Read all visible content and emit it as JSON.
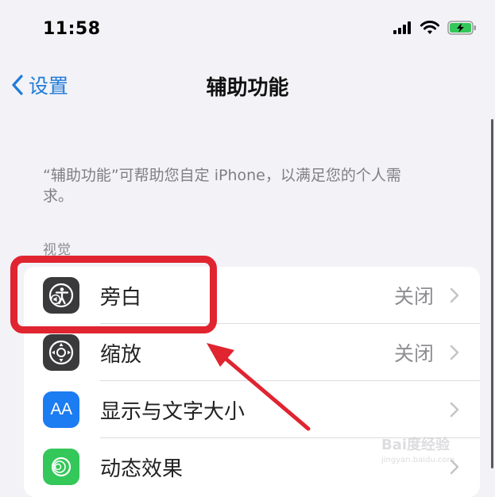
{
  "status_bar": {
    "time": "11:58",
    "icons": [
      "cellular-signal-icon",
      "wifi-icon",
      "battery-charging-icon"
    ]
  },
  "nav": {
    "back_label": "设置",
    "title": "辅助功能"
  },
  "description": "“辅助功能”可帮助您自定 iPhone，以满足您的个人需求。",
  "section_header": "视觉",
  "items": [
    {
      "label": "旁白",
      "value": "关闭",
      "icon": "voiceover-icon",
      "icon_color": "#3a3a3c"
    },
    {
      "label": "缩放",
      "value": "关闭",
      "icon": "zoom-icon",
      "icon_color": "#3a3a3c"
    },
    {
      "label": "显示与文字大小",
      "value": "",
      "icon": "display-text-size-icon",
      "icon_color": "#1c7cf2",
      "icon_text": "AA"
    },
    {
      "label": "动态效果",
      "value": "",
      "icon": "motion-icon",
      "icon_color": "#34c759"
    }
  ],
  "annotation": {
    "highlight_color": "#e02430",
    "highlighted_item": "旁白"
  },
  "watermark": {
    "brand": "Bai度经验",
    "url": "jingyan.baidu.com"
  }
}
